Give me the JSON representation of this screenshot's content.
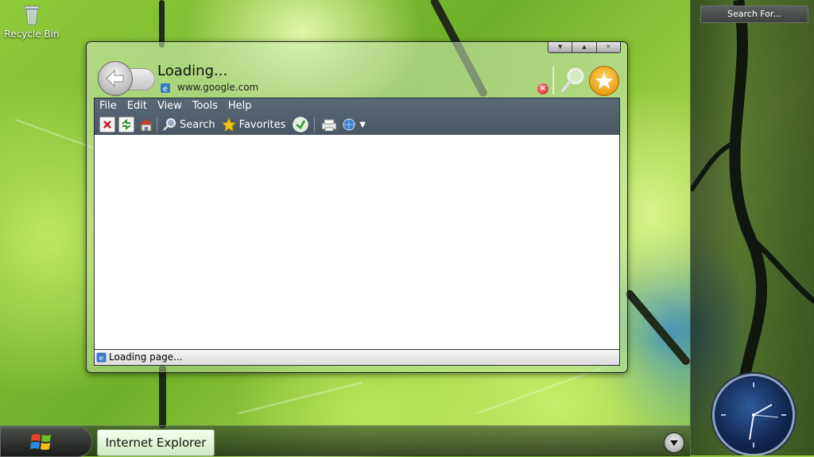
{
  "desktop": {
    "recycle_bin_label": "Recycle Bin"
  },
  "browser": {
    "page_title": "Loading...",
    "url": "www.google.com",
    "menu": [
      "File",
      "Edit",
      "View",
      "Tools",
      "Help"
    ],
    "toolbar": {
      "search_label": "Search",
      "favorites_label": "Favorites"
    },
    "status_text": "Loading page..."
  },
  "sidebar": {
    "search_placeholder": "Search For..."
  },
  "taskbar": {
    "task_label": "Internet Explorer"
  },
  "icons": {
    "back": "back-arrow-icon",
    "stop": "stop-icon",
    "refresh": "refresh-icon",
    "home": "home-icon",
    "search": "magnifier-icon",
    "favorites": "star-icon",
    "history": "history-icon",
    "print": "printer-icon",
    "globe": "globe-icon",
    "start": "windows-logo-icon"
  }
}
